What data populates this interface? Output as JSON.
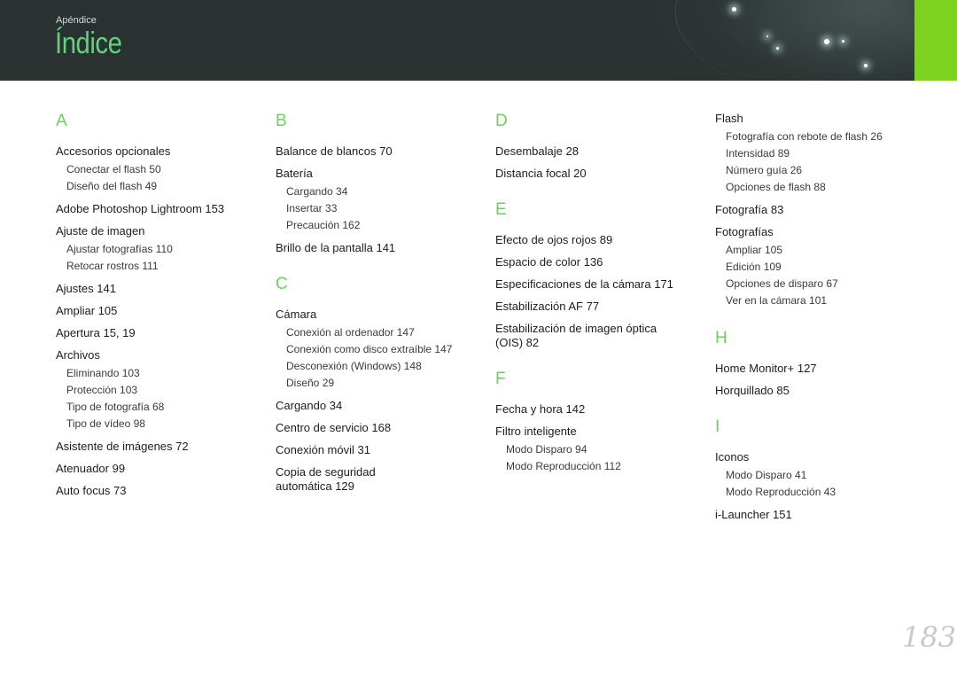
{
  "header": {
    "section": "Apéndice",
    "title": "Índice"
  },
  "columns": [
    {
      "groups": [
        {
          "letter": "A",
          "entries": [
            {
              "label": "Accesorios opcionales",
              "subs": [
                "Conectar el flash  50",
                "Diseño del flash  49"
              ]
            },
            {
              "label": "Adobe Photoshop Lightroom  153",
              "subs": []
            },
            {
              "label": "Ajuste de imagen",
              "subs": [
                "Ajustar fotografías  110",
                "Retocar rostros  111"
              ]
            },
            {
              "label": "Ajustes  141",
              "subs": []
            },
            {
              "label": "Ampliar  105",
              "subs": []
            },
            {
              "label": "Apertura  15, 19",
              "subs": []
            },
            {
              "label": "Archivos",
              "subs": [
                "Eliminando  103",
                "Protección  103",
                "Tipo de fotografía  68",
                "Tipo de vídeo  98"
              ]
            },
            {
              "label": "Asistente de imágenes  72",
              "subs": []
            },
            {
              "label": "Atenuador  99",
              "subs": []
            },
            {
              "label": "Auto focus  73",
              "subs": []
            }
          ]
        }
      ]
    },
    {
      "groups": [
        {
          "letter": "B",
          "entries": [
            {
              "label": "Balance de blancos  70",
              "subs": []
            },
            {
              "label": "Batería",
              "subs": [
                "Cargando  34",
                "Insertar  33",
                "Precaución  162"
              ]
            },
            {
              "label": "Brillo de la pantalla  141",
              "subs": []
            }
          ]
        },
        {
          "letter": "C",
          "entries": [
            {
              "label": "Cámara",
              "subs": [
                "Conexión al ordenador  147",
                "Conexión como disco extraíble  147",
                "Desconexión (Windows)  148",
                "Diseño  29"
              ]
            },
            {
              "label": "Cargando  34",
              "subs": []
            },
            {
              "label": "Centro de servicio  168",
              "subs": []
            },
            {
              "label": "Conexión móvil  31",
              "subs": []
            },
            {
              "label": "Copia de seguridad automática  129",
              "subs": []
            }
          ]
        }
      ]
    },
    {
      "groups": [
        {
          "letter": "D",
          "entries": [
            {
              "label": "Desembalaje  28",
              "subs": []
            },
            {
              "label": "Distancia focal  20",
              "subs": []
            }
          ]
        },
        {
          "letter": "E",
          "entries": [
            {
              "label": "Efecto de ojos rojos  89",
              "subs": []
            },
            {
              "label": "Espacio de color  136",
              "subs": []
            },
            {
              "label": "Especificaciones de la cámara  171",
              "subs": []
            },
            {
              "label": "Estabilización AF  77",
              "subs": []
            },
            {
              "label": "Estabilización de imagen óptica (OIS)  82",
              "subs": []
            }
          ]
        },
        {
          "letter": "F",
          "entries": [
            {
              "label": "Fecha y hora  142",
              "subs": []
            },
            {
              "label": "Filtro inteligente",
              "subs": [
                "Modo Disparo  94",
                "Modo Reproducción  112"
              ]
            }
          ]
        }
      ]
    },
    {
      "groups": [
        {
          "letter": "",
          "entries": [
            {
              "label": "Flash",
              "subs": [
                "Fotografía con rebote de flash  26",
                "Intensidad  89",
                "Número guía  26",
                "Opciones de flash  88"
              ]
            },
            {
              "label": "Fotografía  83",
              "subs": []
            },
            {
              "label": "Fotografías",
              "subs": [
                "Ampliar  105",
                "Edición  109",
                "Opciones de disparo  67",
                "Ver en la cámara  101"
              ]
            }
          ]
        },
        {
          "letter": "H",
          "entries": [
            {
              "label": "Home Monitor+  127",
              "subs": []
            },
            {
              "label": "Horquillado  85",
              "subs": []
            }
          ]
        },
        {
          "letter": "I",
          "entries": [
            {
              "label": "Iconos",
              "subs": [
                "Modo Disparo  41",
                "Modo Reproducción  43"
              ]
            },
            {
              "label": "i-Launcher  151",
              "subs": []
            }
          ]
        }
      ]
    }
  ],
  "page_number": "183"
}
